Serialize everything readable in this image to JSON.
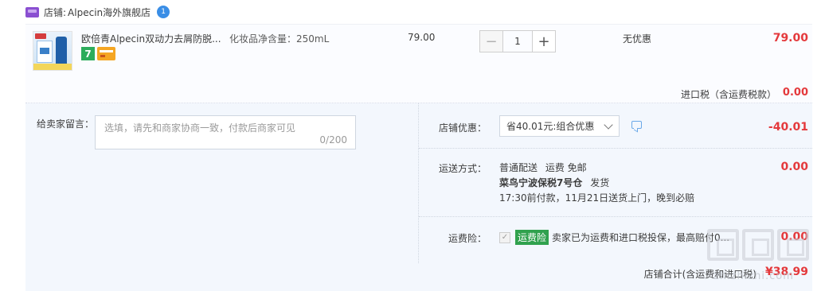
{
  "shop": {
    "label": "店铺:",
    "name": "Alpecin海外旗舰店",
    "badge": "1"
  },
  "item": {
    "title": "欧倍青Alpecin双动力去屑防脱...",
    "spec": "化妆品净含量：250mL",
    "unit_price": "79.00",
    "quantity": "1",
    "minus_symbol": "−",
    "plus_symbol": "+",
    "tag_seven": "7",
    "discount": "无优惠",
    "line_total": "79.00",
    "tax_label": "进口税（含运费税款）",
    "tax_value": "0.00"
  },
  "message": {
    "label": "给卖家留言：",
    "placeholder": "选填，请先和商家协商一致，付款后商家可见",
    "counter": "0/200"
  },
  "promotion": {
    "label": "店铺优惠：",
    "selected": "省40.01元:组合优惠",
    "value": "-40.01"
  },
  "shipping": {
    "label": "运送方式：",
    "line1_method": "普通配送",
    "line1_fee": "运费 免邮",
    "line2_warehouse": "菜鸟宁波保税7号仓",
    "line2_action": "发货",
    "line3": "17:30前付款，11月21日送货上门，晚到必赔",
    "value": "0.00"
  },
  "insurance": {
    "label": "运费险：",
    "badge": "运费险",
    "text": "卖家已为运费和进口税投保，最高赔付0...",
    "value": "0.00"
  },
  "total": {
    "label": "店铺合计(含运费和进口税)",
    "value": "¥38.99"
  },
  "watermark": {
    "text": "zhizhizhi.com"
  },
  "colors": {
    "price_red": "#e4393c",
    "panel_blue": "#f3f7fd",
    "insure_green": "#30a14e"
  }
}
